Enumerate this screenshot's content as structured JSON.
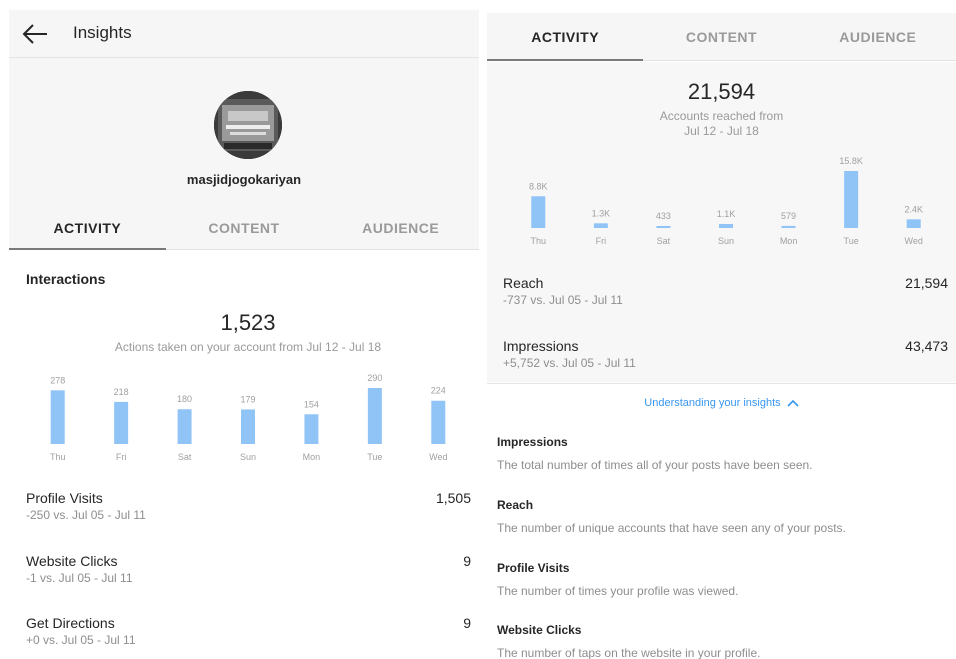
{
  "left": {
    "topbar": {
      "title": "Insights"
    },
    "profile": {
      "username": "masjidjogokariyan"
    },
    "tabs": [
      {
        "label": "ACTIVITY",
        "active": true
      },
      {
        "label": "CONTENT",
        "active": false
      },
      {
        "label": "AUDIENCE",
        "active": false
      }
    ],
    "interactions": {
      "title": "Interactions",
      "total": "1,523",
      "caption": "Actions taken on your account from Jul 12 - Jul 18"
    },
    "metrics": [
      {
        "name": "Profile Visits",
        "delta": "-250 vs. Jul 05 - Jul 11",
        "value": "1,505"
      },
      {
        "name": "Website Clicks",
        "delta": "-1 vs. Jul 05 - Jul 11",
        "value": "9"
      },
      {
        "name": "Get Directions",
        "delta": "+0 vs. Jul 05 - Jul 11",
        "value": "9"
      }
    ]
  },
  "right": {
    "tabs": [
      {
        "label": "ACTIVITY",
        "active": true
      },
      {
        "label": "CONTENT",
        "active": false
      },
      {
        "label": "AUDIENCE",
        "active": false
      }
    ],
    "reach_summary": {
      "total": "21,594",
      "caption_line1": "Accounts reached from",
      "caption_line2": "Jul 12 - Jul 18"
    },
    "metrics": [
      {
        "name": "Reach",
        "delta": "-737 vs. Jul 05 - Jul 11",
        "value": "21,594"
      },
      {
        "name": "Impressions",
        "delta": "+5,752 vs. Jul 05 - Jul 11",
        "value": "43,473"
      }
    ],
    "understanding_link": "Understanding your insights",
    "definitions": [
      {
        "title": "Impressions",
        "text": "The total number of times all of your posts have been seen."
      },
      {
        "title": "Reach",
        "text": "The number of unique accounts that have seen any of your posts."
      },
      {
        "title": "Profile Visits",
        "text": "The number of times your profile was viewed."
      },
      {
        "title": "Website Clicks",
        "text": "The number of taps on the website in your profile."
      }
    ]
  },
  "colors": {
    "bar": "#90c4f7",
    "link": "#3897f0",
    "text": "#262626",
    "muted": "#8e8e8e"
  },
  "chart_data": [
    {
      "type": "bar",
      "categories": [
        "Thu",
        "Fri",
        "Sat",
        "Sun",
        "Mon",
        "Tue",
        "Wed"
      ],
      "values": [
        278,
        218,
        180,
        179,
        154,
        290,
        224
      ],
      "labels": [
        "278",
        "218",
        "180",
        "179",
        "154",
        "290",
        "224"
      ],
      "ylim": [
        0,
        290
      ]
    },
    {
      "type": "bar",
      "categories": [
        "Thu",
        "Fri",
        "Sat",
        "Sun",
        "Mon",
        "Tue",
        "Wed"
      ],
      "values": [
        8800,
        1300,
        433,
        1100,
        579,
        15800,
        2400
      ],
      "labels": [
        "8.8K",
        "1.3K",
        "433",
        "1.1K",
        "579",
        "15.8K",
        "2.4K"
      ],
      "ylim": [
        0,
        15800
      ]
    }
  ]
}
